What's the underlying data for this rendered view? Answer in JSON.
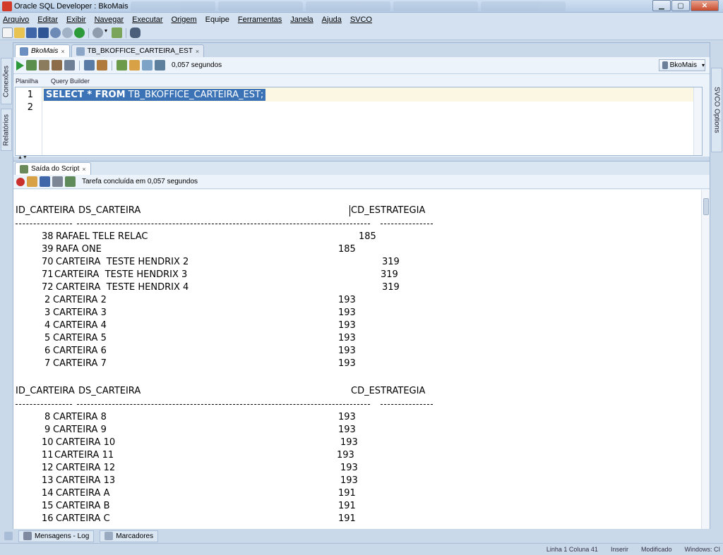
{
  "window": {
    "title": "Oracle SQL Developer : BkoMais"
  },
  "menu": [
    "Arquivo",
    "Editar",
    "Exibir",
    "Navegar",
    "Executar",
    "Origem",
    "Equipe",
    "Ferramentas",
    "Janela",
    "Ajuda",
    "SVCO"
  ],
  "side_tabs": {
    "left": [
      "Conexões",
      "Relatórios"
    ],
    "right": [
      "SVCO Options"
    ]
  },
  "document_tabs": [
    {
      "label": "BkoMais",
      "active": true
    },
    {
      "label": "TB_BKOFFICE_CARTEIRA_EST",
      "active": false
    }
  ],
  "editor": {
    "elapsed": "0,057 segundos",
    "connection": "BkoMais",
    "subtabs": [
      "Planilha",
      "Query Builder"
    ],
    "line_numbers": [
      "1",
      "2"
    ],
    "sql_keywords": "SELECT * FROM",
    "sql_rest": " TB_BKOFFICE_CARTEIRA_EST;"
  },
  "output": {
    "tab_label": "Saída do Script",
    "status": "Tarefa concluída em 0,057 segundos",
    "header": {
      "id": "ID_CARTEIRA",
      "ds": "DS_CARTEIRA",
      "cd": "CD_ESTRATEGIA"
    },
    "block1": [
      {
        "id": "38",
        "ds": "RAFAEL TELE RELAC",
        "cd": "185"
      },
      {
        "id": "39",
        "ds": "RAFA ONE",
        "cd": "185"
      },
      {
        "id": "70",
        "ds": "CARTEIRA  TESTE HENDRIX 2",
        "cd": "319"
      },
      {
        "id": "71",
        "ds": "CARTEIRA  TESTE HENDRIX 3",
        "cd": "319"
      },
      {
        "id": "72",
        "ds": "CARTEIRA  TESTE HENDRIX 4",
        "cd": "319"
      },
      {
        "id": "2",
        "ds": "CARTEIRA 2",
        "cd": "193"
      },
      {
        "id": "3",
        "ds": "CARTEIRA 3",
        "cd": "193"
      },
      {
        "id": "4",
        "ds": "CARTEIRA 4",
        "cd": "193"
      },
      {
        "id": "5",
        "ds": "CARTEIRA 5",
        "cd": "193"
      },
      {
        "id": "6",
        "ds": "CARTEIRA 6",
        "cd": "193"
      },
      {
        "id": "7",
        "ds": "CARTEIRA 7",
        "cd": "193"
      }
    ],
    "block2": [
      {
        "id": "8",
        "ds": "CARTEIRA 8",
        "cd": "193"
      },
      {
        "id": "9",
        "ds": "CARTEIRA 9",
        "cd": "193"
      },
      {
        "id": "10",
        "ds": "CARTEIRA 10",
        "cd": "193"
      },
      {
        "id": "11",
        "ds": "CARTEIRA 11",
        "cd": "193"
      },
      {
        "id": "12",
        "ds": "CARTEIRA 12",
        "cd": "193"
      },
      {
        "id": "13",
        "ds": "CARTEIRA 13",
        "cd": "193"
      },
      {
        "id": "14",
        "ds": "CARTEIRA A",
        "cd": "191"
      },
      {
        "id": "15",
        "ds": "CARTEIRA B",
        "cd": "191"
      },
      {
        "id": "16",
        "ds": "CARTEIRA C",
        "cd": "191"
      }
    ]
  },
  "bottom_tabs": [
    "Mensagens - Log",
    "Marcadores"
  ],
  "statusbar": [
    "Linha 1 Coluna 41",
    "Inserir",
    "Modificado",
    "Windows: CI"
  ]
}
